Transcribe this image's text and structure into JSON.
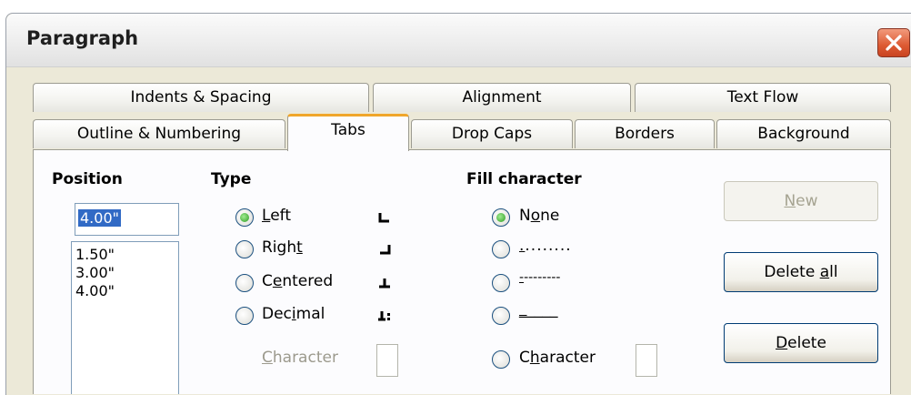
{
  "window": {
    "title": "Paragraph"
  },
  "tabs": {
    "row1": [
      "Indents & Spacing",
      "Alignment",
      "Text Flow"
    ],
    "row2": [
      "Outline & Numbering",
      "Tabs",
      "Drop Caps",
      "Borders",
      "Background"
    ],
    "active": "Tabs"
  },
  "position": {
    "label": "Position",
    "input_value": "4.00\"",
    "list": [
      "1.50\"",
      "3.00\"",
      "4.00\""
    ]
  },
  "type": {
    "label": "Type",
    "options": [
      {
        "pre": "",
        "u": "L",
        "post": "eft",
        "checked": true
      },
      {
        "pre": "Righ",
        "u": "t",
        "post": "",
        "checked": false
      },
      {
        "pre": "C",
        "u": "e",
        "post": "ntered",
        "checked": false
      },
      {
        "pre": "Dec",
        "u": "i",
        "post": "mal",
        "checked": false
      }
    ],
    "character": {
      "pre": "",
      "u": "C",
      "post": "haracter"
    }
  },
  "fill": {
    "label": "Fill character",
    "options": [
      {
        "pre": "N",
        "u": "o",
        "post": "ne",
        "checked": true
      },
      {
        "pre": "",
        "u": ".",
        "post": "........",
        "checked": false
      },
      {
        "pre": "",
        "u": "-",
        "post": "--------",
        "checked": false
      },
      {
        "pre": "",
        "u": "_",
        "post": "____",
        "checked": false
      },
      {
        "pre": "C",
        "u": "h",
        "post": "aracter",
        "checked": false
      }
    ]
  },
  "buttons": {
    "new": {
      "pre": "",
      "u": "N",
      "post": "ew",
      "enabled": false
    },
    "delete_all": {
      "pre": "Delete ",
      "u": "a",
      "post": "ll",
      "enabled": true
    },
    "delete": {
      "pre": "",
      "u": "D",
      "post": "elete",
      "enabled": true
    }
  },
  "icons": [
    "close-icon",
    "tab-left-icon",
    "tab-right-icon",
    "tab-centered-icon",
    "tab-decimal-icon"
  ],
  "colors": {
    "accent_tab": "#f0a62b",
    "dialog_bg": "#ece9d8",
    "close_button": "#dd5a33"
  }
}
